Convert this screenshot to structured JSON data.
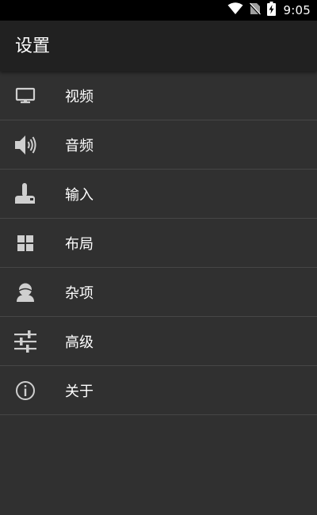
{
  "status_bar": {
    "time": "9:05",
    "icons": [
      "wifi-icon",
      "no-sim-icon",
      "battery-charging-icon"
    ]
  },
  "app_bar": {
    "title": "设置"
  },
  "menu": {
    "items": [
      {
        "label": "视频",
        "icon": "monitor-icon"
      },
      {
        "label": "音频",
        "icon": "speaker-icon"
      },
      {
        "label": "输入",
        "icon": "joystick-icon"
      },
      {
        "label": "布局",
        "icon": "grid-icon"
      },
      {
        "label": "杂项",
        "icon": "person-icon"
      },
      {
        "label": "高级",
        "icon": "sliders-icon"
      },
      {
        "label": "关于",
        "icon": "info-icon"
      }
    ]
  },
  "colors": {
    "background": "#303030",
    "app_bar": "#212121",
    "status_bar": "#000000",
    "divider": "#464646",
    "icon": "#cfcfcf",
    "text": "#ffffff"
  }
}
